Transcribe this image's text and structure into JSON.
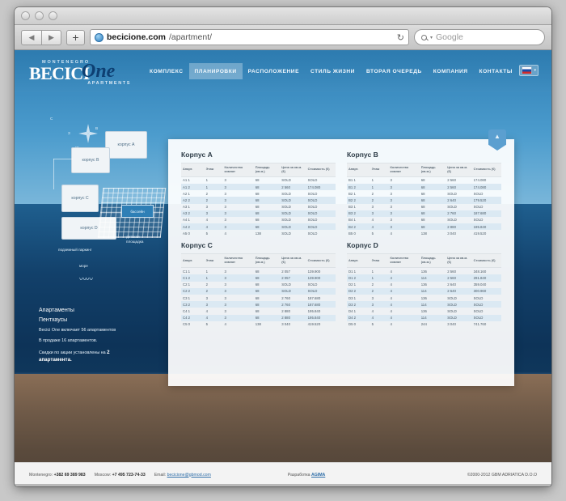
{
  "browser": {
    "url_host": "becicione.com",
    "url_path": "/apartment/",
    "search_placeholder": "Google",
    "back_icon": "◀",
    "forward_icon": "▶",
    "add_tab_icon": "+",
    "reload_icon": "↻"
  },
  "header": {
    "logo_montenegro": "MONTENEGRO",
    "logo_becici": "BECICI",
    "logo_one": "One",
    "logo_apartments": "APARTMENTS",
    "nav": [
      {
        "label": "КОМПЛЕКС",
        "active": false
      },
      {
        "label": "ПЛАНИРОВКИ",
        "active": true
      },
      {
        "label": "РАСПОЛОЖЕНИЕ",
        "active": false
      },
      {
        "label": "СТИЛЬ ЖИЗНИ",
        "active": false
      },
      {
        "label": "ВТОРАЯ ОЧЕРЕДЬ",
        "active": false
      },
      {
        "label": "КОМПАНИЯ",
        "active": false
      },
      {
        "label": "КОНТАКТЫ",
        "active": false
      }
    ],
    "language_flag": "ru"
  },
  "siteplan": {
    "compass_n": "С",
    "compass_e": "В",
    "compass_s": "Ю",
    "compass_w": "З",
    "buildings": [
      {
        "label": "корпус A"
      },
      {
        "label": "корпус B"
      },
      {
        "label": "корпус C"
      },
      {
        "label": "корпус D"
      }
    ],
    "pool_label": "бассейн",
    "playground_label": "детская площадка",
    "parking_label": "подземный паркинг",
    "sea_label": "море"
  },
  "sidebar": {
    "heading_apartments": "Апартаменты",
    "heading_penthouses": "Пентхаусы",
    "note_1": "Becici One включает 56 апартаментов",
    "note_2": "В продаже 16 апартаментов.",
    "note_3_pre": "Скидки по акции установлены на ",
    "note_3_strong": "2 апартамента."
  },
  "panel": {
    "collapse_icon": "▲",
    "columns": [
      "Апарт.",
      "Этаж",
      "Количество комнат",
      "Площадь (кв.м.)",
      "Цена за кв.м. (€)",
      "Стоимость (€)"
    ],
    "blocks": [
      {
        "title": "Корпус A",
        "rows": [
          [
            "A1 1",
            "1",
            "3",
            "68",
            "SOLD",
            "SOLD"
          ],
          [
            "A1 2",
            "1",
            "3",
            "68",
            "2 560",
            "174.080"
          ],
          [
            "A2 1",
            "2",
            "3",
            "68",
            "SOLD",
            "SOLD"
          ],
          [
            "A2 2",
            "2",
            "3",
            "68",
            "SOLD",
            "SOLD"
          ],
          [
            "A3 1",
            "3",
            "3",
            "68",
            "SOLD",
            "SOLD"
          ],
          [
            "A3 2",
            "3",
            "3",
            "68",
            "SOLD",
            "SOLD"
          ],
          [
            "A4 1",
            "4",
            "3",
            "68",
            "SOLD",
            "SOLD"
          ],
          [
            "A4 2",
            "4",
            "3",
            "68",
            "SOLD",
            "SOLD"
          ],
          [
            "A5 0",
            "5",
            "4",
            "138",
            "SOLD",
            "SOLD"
          ]
        ]
      },
      {
        "title": "Корпус B",
        "rows": [
          [
            "B1 1",
            "1",
            "3",
            "68",
            "2 560",
            "174.080"
          ],
          [
            "B1 2",
            "1",
            "3",
            "68",
            "2 560",
            "174.080"
          ],
          [
            "B2 1",
            "2",
            "3",
            "68",
            "SOLD",
            "SOLD"
          ],
          [
            "B2 2",
            "2",
            "3",
            "68",
            "2 640",
            "179.520"
          ],
          [
            "B3 1",
            "3",
            "3",
            "68",
            "SOLD",
            "SOLD"
          ],
          [
            "B3 2",
            "3",
            "3",
            "68",
            "2 760",
            "187.680"
          ],
          [
            "B4 1",
            "4",
            "3",
            "68",
            "SOLD",
            "SOLD"
          ],
          [
            "B4 2",
            "4",
            "3",
            "68",
            "2 880",
            "195.840"
          ],
          [
            "B5 0",
            "5",
            "4",
            "138",
            "3 040",
            "419.520"
          ]
        ]
      },
      {
        "title": "Корпус C",
        "rows": [
          [
            "C1 1",
            "1",
            "3",
            "68",
            "2 057",
            "139.900"
          ],
          [
            "C1 2",
            "1",
            "3",
            "68",
            "2 057",
            "139.900"
          ],
          [
            "C2 1",
            "2",
            "3",
            "68",
            "SOLD",
            "SOLD"
          ],
          [
            "C2 2",
            "2",
            "3",
            "68",
            "SOLD",
            "SOLD"
          ],
          [
            "C3 1",
            "3",
            "3",
            "68",
            "2 760",
            "187.680"
          ],
          [
            "C3 2",
            "3",
            "3",
            "68",
            "2 760",
            "187.680"
          ],
          [
            "C4 1",
            "4",
            "3",
            "68",
            "2 880",
            "195.840"
          ],
          [
            "C4 2",
            "4",
            "3",
            "68",
            "2 880",
            "195.840"
          ],
          [
            "C5 0",
            "5",
            "4",
            "138",
            "3 040",
            "419.520"
          ]
        ]
      },
      {
        "title": "Корпус D",
        "rows": [
          [
            "D1 1",
            "1",
            "4",
            "136",
            "2 560",
            "348.160"
          ],
          [
            "D1 2",
            "1",
            "4",
            "114",
            "2 560",
            "291.840"
          ],
          [
            "D2 1",
            "2",
            "4",
            "136",
            "2 640",
            "359.040"
          ],
          [
            "D2 2",
            "2",
            "4",
            "114",
            "2 640",
            "300.960"
          ],
          [
            "D3 1",
            "3",
            "4",
            "136",
            "SOLD",
            "SOLD"
          ],
          [
            "D3 2",
            "3",
            "4",
            "114",
            "SOLD",
            "SOLD"
          ],
          [
            "D4 1",
            "4",
            "4",
            "136",
            "SOLD",
            "SOLD"
          ],
          [
            "D4 2",
            "4",
            "4",
            "114",
            "SOLD",
            "SOLD"
          ],
          [
            "D5 0",
            "5",
            "4",
            "244",
            "3 040",
            "741.760"
          ]
        ]
      }
    ]
  },
  "footer": {
    "montenegro_label": "Montenegro:",
    "montenegro_phone": "+382 69 389 983",
    "moscow_label": "Moscow:",
    "moscow_phone": "+7 495 723-74-33",
    "email_label": "Email:",
    "email": "becicione@gbmod.com",
    "dev_label": "Разработка",
    "dev_name": "AGIMA",
    "copyright": "©2000-2012 GBM ADRIATICA D.O.O"
  }
}
